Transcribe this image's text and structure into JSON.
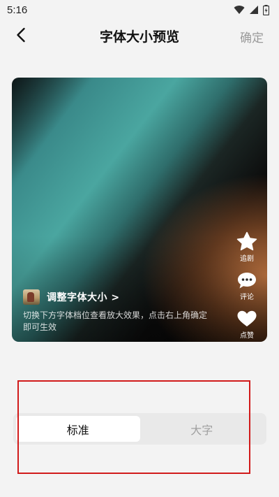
{
  "status_bar": {
    "time": "5:16",
    "icons": [
      "wifi-icon",
      "signal-icon",
      "battery-icon"
    ]
  },
  "nav": {
    "title": "字体大小预览",
    "confirm_label": "确定",
    "back_icon": "chevron-left-icon"
  },
  "preview": {
    "side_actions": [
      {
        "icon": "star-icon",
        "label": "追剧"
      },
      {
        "icon": "comment-icon",
        "label": "评论"
      },
      {
        "icon": "heart-icon",
        "label": "点赞"
      }
    ],
    "title": "调整字体大小 >",
    "description": "切换下方字体档位查看放大效果，点击右上角确定即可生效"
  },
  "font_size_selector": {
    "options": [
      {
        "label": "标准",
        "selected": true
      },
      {
        "label": "大字",
        "selected": false
      }
    ]
  },
  "colors": {
    "background": "#f3f3f3",
    "highlight_frame": "#d11a1a",
    "confirm_disabled": "#9a9a9a"
  }
}
